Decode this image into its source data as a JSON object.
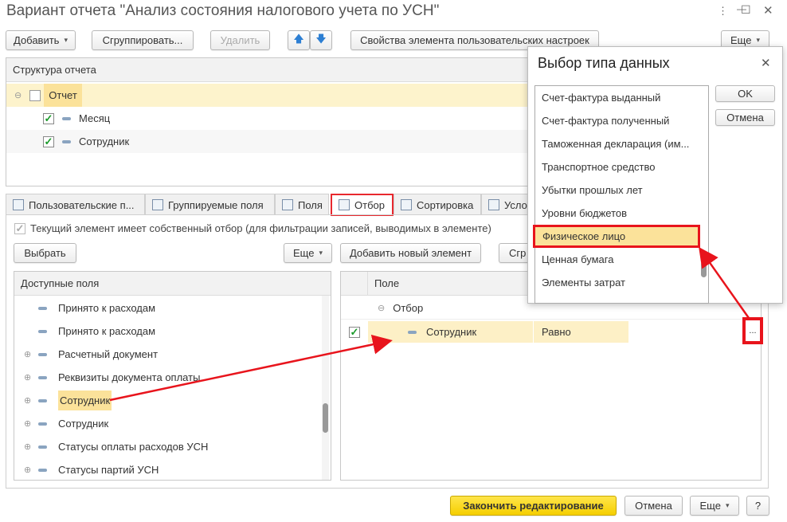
{
  "window": {
    "title": "Вариант отчета \"Анализ состояния налогового учета по УСН\"",
    "more": "⋮",
    "min": "—",
    "max": "☐",
    "close": "✕"
  },
  "toolbar": {
    "add": "Добавить",
    "group": "Сгруппировать...",
    "delete": "Удалить",
    "up": "🡅",
    "down": "🡇",
    "properties": "Свойства элемента пользовательских настроек",
    "more": "Еще"
  },
  "structure": {
    "header": "Структура отчета",
    "rows": [
      {
        "label": "Отчет"
      },
      {
        "label": "Месяц"
      },
      {
        "label": "Сотрудник"
      }
    ]
  },
  "tabs": [
    "Пользовательские п...",
    "Группируемые поля",
    "Поля",
    "Отбор",
    "Сортировка",
    "Усло"
  ],
  "filter": {
    "own_filter_label": "Текущий элемент имеет собственный отбор (для фильтрации записей, выводимых в элементе)",
    "select": "Выбрать",
    "more": "Еще",
    "add_new": "Добавить новый элемент",
    "group": "Сгр"
  },
  "available": {
    "header": "Доступные поля",
    "items": [
      "Принято к расходам",
      "Принято к расходам",
      "Расчетный документ",
      "Реквизиты документа оплаты",
      "Сотрудник",
      "Сотрудник",
      "Статусы оплаты расходов УСН",
      "Статусы партий УСН"
    ]
  },
  "filter_table": {
    "header": "Поле",
    "group": "Отбор",
    "row": {
      "field": "Сотрудник",
      "condition": "Равно",
      "choose": "..."
    }
  },
  "dialog": {
    "title": "Выбор типа данных",
    "close": "✕",
    "ok": "OK",
    "cancel": "Отмена",
    "items": [
      "Счет-фактура выданный",
      "Счет-фактура полученный",
      "Таможенная декларация (им...",
      "Транспортное средство",
      "Убытки прошлых лет",
      "Уровни бюджетов",
      "Физическое лицо",
      "Ценная бумага",
      "Элементы затрат"
    ],
    "selected": "Физическое лицо"
  },
  "footer": {
    "finish": "Закончить редактирование",
    "cancel": "Отмена",
    "more": "Еще",
    "help": "?"
  }
}
